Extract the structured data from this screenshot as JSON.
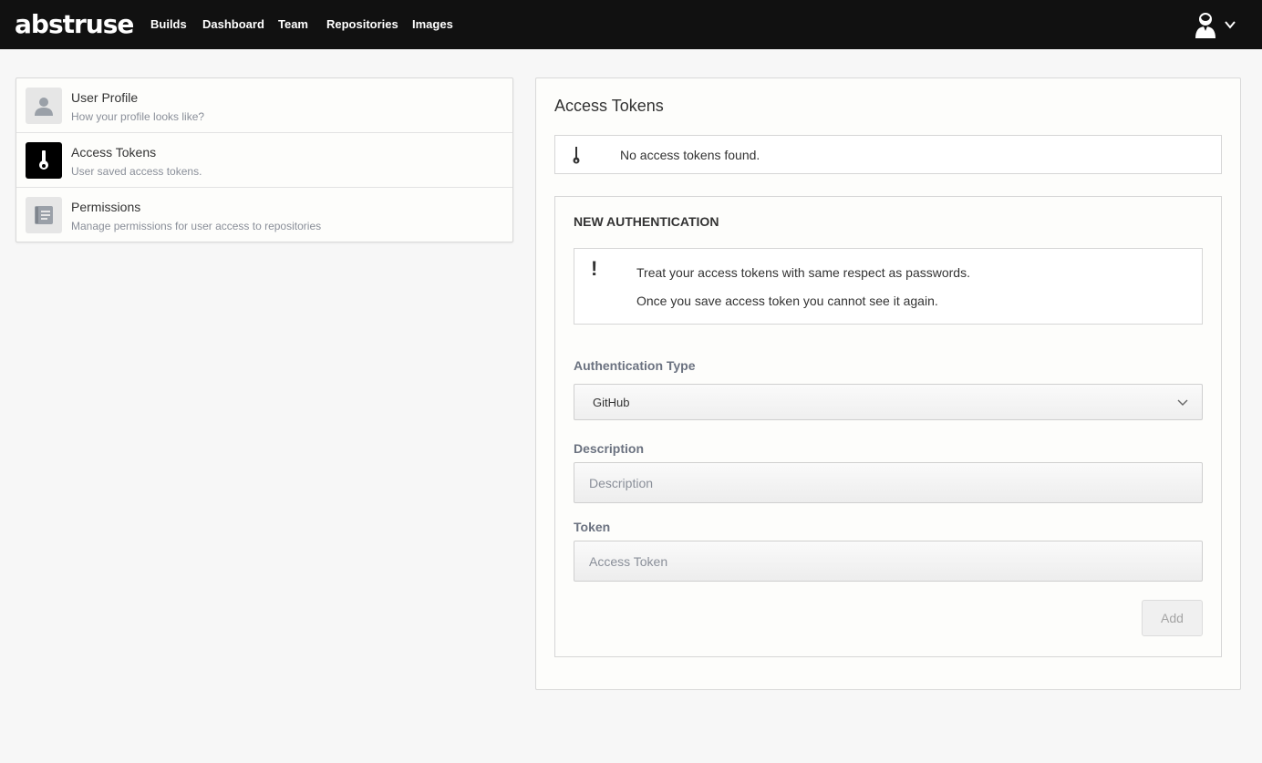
{
  "app": {
    "logo": "abstruse"
  },
  "nav": {
    "items": [
      {
        "label": "Builds"
      },
      {
        "label": "Dashboard"
      },
      {
        "label": "Team"
      },
      {
        "label": "Repositories"
      },
      {
        "label": "Images"
      }
    ],
    "user_icon": "user-avatar-icon",
    "dropdown_icon": "chevron-down-icon"
  },
  "settings_menu": {
    "items": [
      {
        "title": "User Profile",
        "subtitle": "How your profile looks like?",
        "icon": "user-icon",
        "active": false
      },
      {
        "title": "Access Tokens",
        "subtitle": "User saved access tokens.",
        "icon": "key-icon",
        "active": true
      },
      {
        "title": "Permissions",
        "subtitle": "Manage permissions for user access to repositories",
        "icon": "document-icon",
        "active": false
      }
    ]
  },
  "main": {
    "title": "Access Tokens",
    "empty_message": "No access tokens found.",
    "empty_icon": "key-icon",
    "new_auth": {
      "title": "NEW AUTHENTICATION",
      "warning_icon": "exclamation-icon",
      "warning_lines": [
        "Treat your access tokens with same respect as passwords.",
        "Once you save access token you cannot see it again."
      ],
      "auth_type_label": "Authentication Type",
      "auth_type_value": "GitHub",
      "description_label": "Description",
      "description_placeholder": "Description",
      "description_value": "",
      "token_label": "Token",
      "token_placeholder": "Access Token",
      "token_value": "",
      "add_button": "Add"
    }
  },
  "colors": {
    "topbar": "#111111",
    "background": "#f7f7f7",
    "card": "#fdfdfb",
    "active_icon_bg": "#000000",
    "muted_text": "#8a8f99"
  }
}
